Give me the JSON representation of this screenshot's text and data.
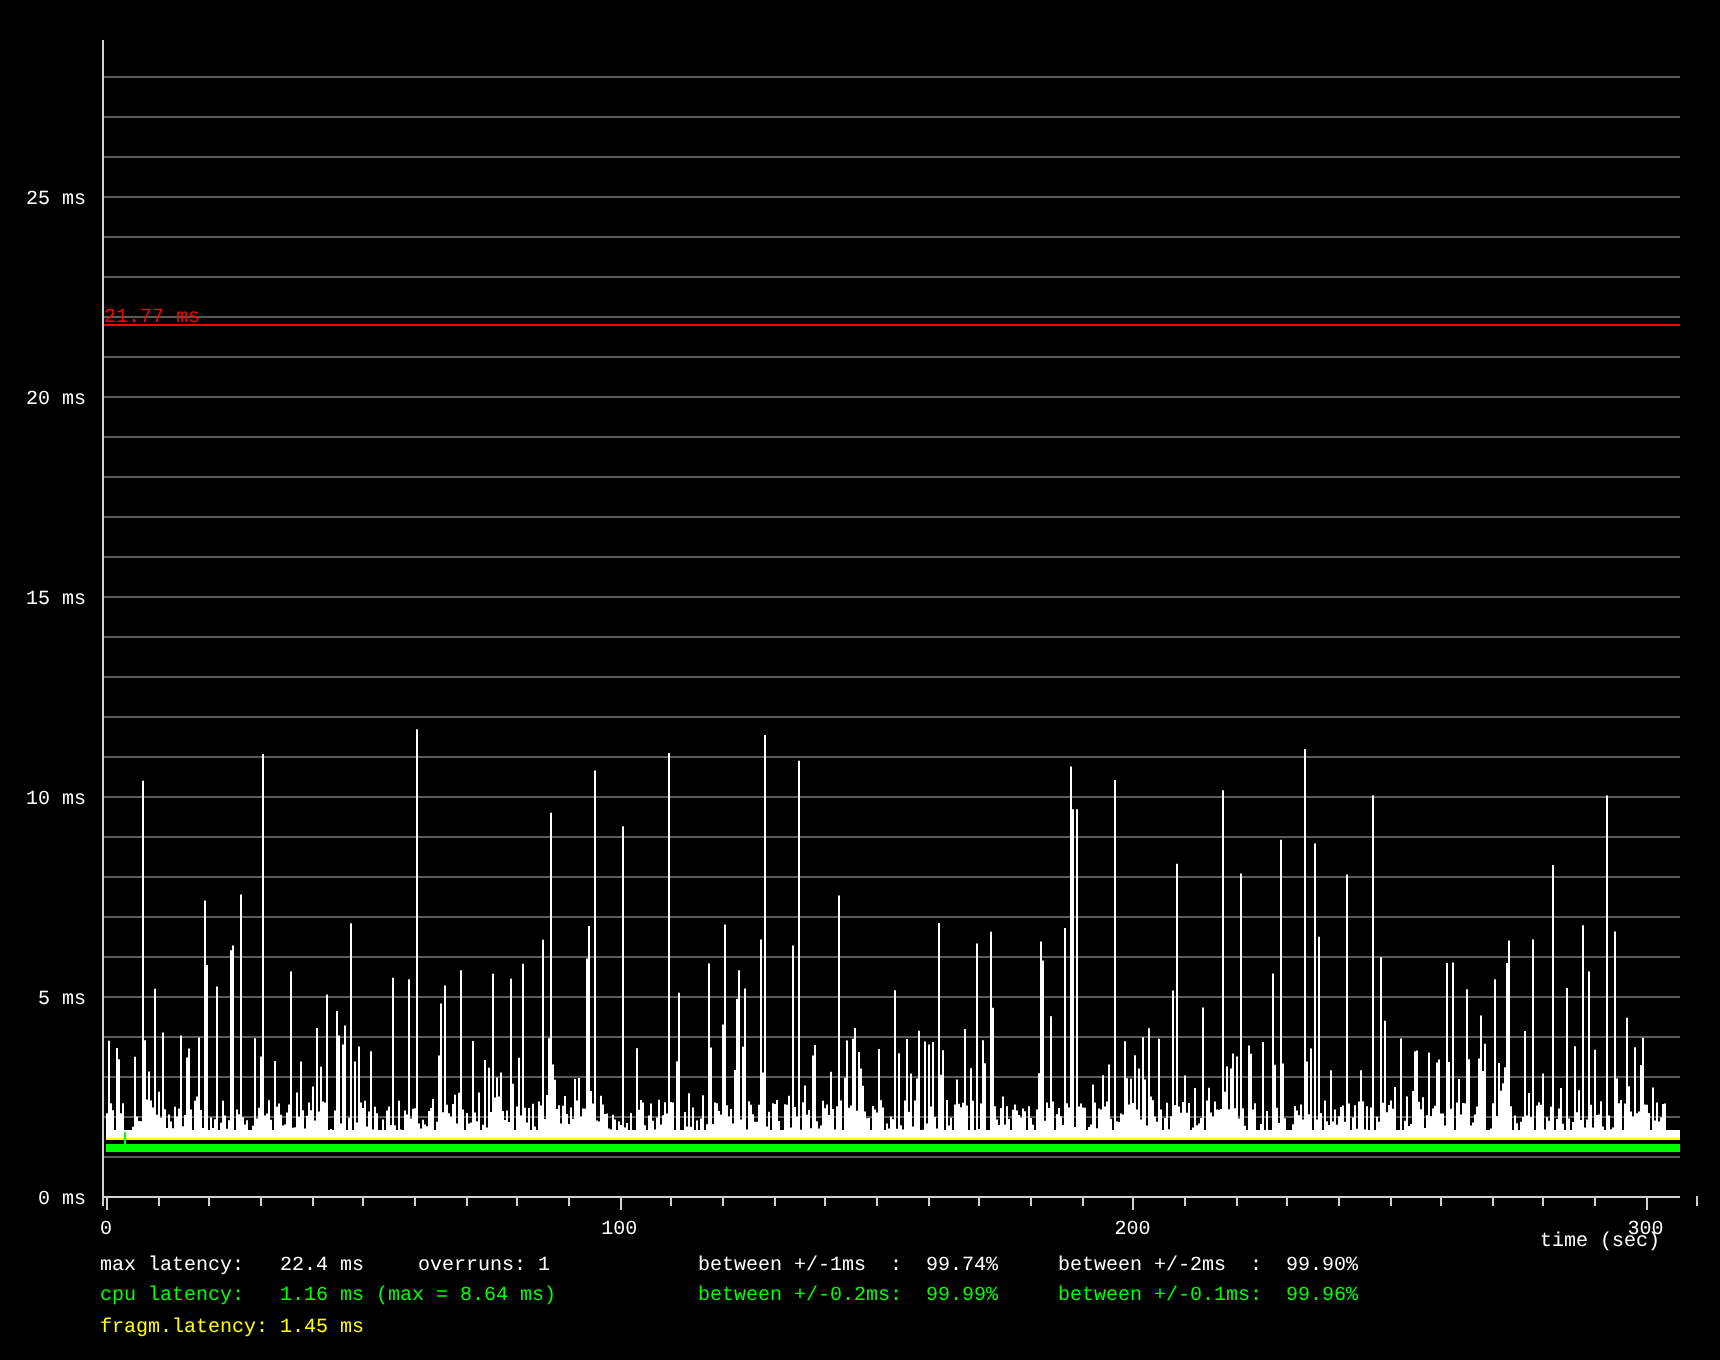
{
  "chart": {
    "y_labels": [
      "25 ms",
      "20 ms",
      "15 ms",
      "10 ms",
      "5 ms",
      "0 ms"
    ],
    "x_labels": [
      "0",
      "100",
      "200",
      "300"
    ],
    "x_title": "time (sec)",
    "max_marker": "21.77 ms"
  },
  "stats": [
    {
      "color": "#ffffff",
      "cells": [
        "max latency:   22.4 ms",
        "overruns: 1",
        "between +/-1ms  :  99.74%",
        "between +/-2ms  :  99.90%"
      ]
    },
    {
      "color": "#00ff00",
      "cells": [
        "cpu latency:   1.16 ms (max = 8.64 ms)",
        "between +/-0.2ms:  99.99%",
        "between +/-0.1ms:  99.96%"
      ]
    },
    {
      "color": "#ffff00",
      "cells": [
        "fragm.latency: 1.45 ms"
      ]
    }
  ]
}
